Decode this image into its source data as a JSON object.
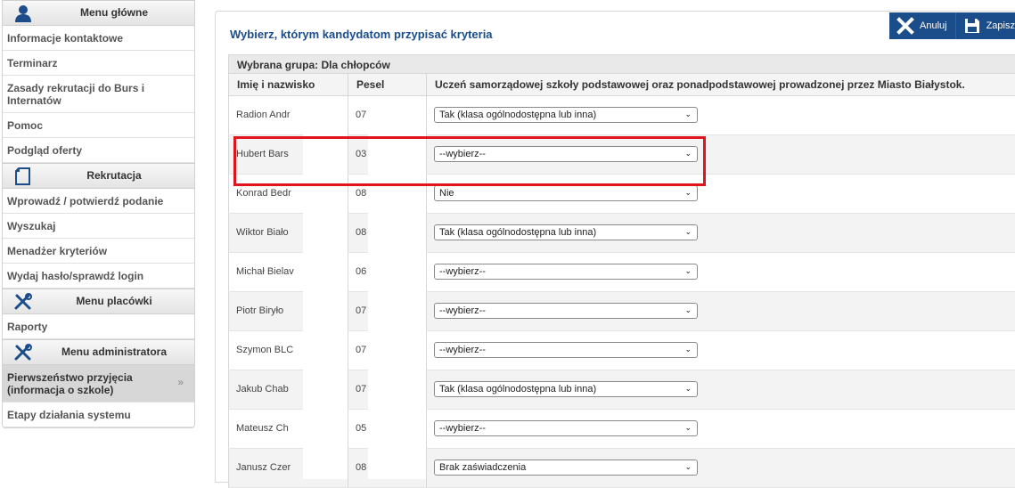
{
  "sidebar": {
    "menu_glowne": {
      "title": "Menu główne",
      "icon": "user-icon",
      "items": [
        {
          "label": "Informacje kontaktowe"
        },
        {
          "label": "Terminarz"
        },
        {
          "label": "Zasady rekrutacji do Burs i Internatów"
        },
        {
          "label": "Pomoc"
        },
        {
          "label": "Podgląd oferty"
        }
      ]
    },
    "rekrutacja": {
      "title": "Rekrutacja",
      "icon": "document-icon",
      "items": [
        {
          "label": "Wprowadź / potwierdź podanie"
        },
        {
          "label": "Wyszukaj"
        },
        {
          "label": "Menadżer kryteriów"
        },
        {
          "label": "Wydaj hasło/sprawdź login"
        }
      ]
    },
    "menu_placowki": {
      "title": "Menu placówki",
      "icon": "tools-icon",
      "items": [
        {
          "label": "Raporty"
        }
      ]
    },
    "menu_administratora": {
      "title": "Menu administratora",
      "icon": "tools-icon",
      "items": [
        {
          "label": "Pierwszeństwo przyjęcia (informacja o szkole)",
          "active": true,
          "chevron": "»"
        },
        {
          "label": "Etapy działania systemu"
        }
      ]
    }
  },
  "main": {
    "title": "Wybierz, którym kandydatom przypisać kryteria",
    "buttons": {
      "cancel": "Anuluj",
      "save": "Zapisz"
    },
    "group_label": "Wybrana grupa: Dla chłopców",
    "columns": [
      "Imię i nazwisko",
      "Pesel",
      "Uczeń samorządowej szkoły podstawowej oraz ponadpodstawowej prowadzonej przez Miasto Białystok."
    ],
    "rows": [
      {
        "name": "Radion Andr",
        "pesel": "07",
        "value": "Tak (klasa ogólnodostępna lub inna)"
      },
      {
        "name": "Hubert Bars",
        "pesel": "03",
        "value": "--wybierz--"
      },
      {
        "name": "Konrad Bedr",
        "pesel": "08",
        "value": "Nie"
      },
      {
        "name": "Wiktor Biało",
        "pesel": "08",
        "value": "Tak (klasa ogólnodostępna lub inna)"
      },
      {
        "name": "Michał Bielav",
        "pesel": "06",
        "value": "--wybierz--"
      },
      {
        "name": "Piotr Biryło",
        "pesel": "07",
        "value": "--wybierz--"
      },
      {
        "name": "Szymon BLC",
        "pesel": "07",
        "value": "--wybierz--"
      },
      {
        "name": "Jakub Chab",
        "pesel": "07",
        "value": "Tak (klasa ogólnodostępna lub inna)"
      },
      {
        "name": "Mateusz Ch",
        "pesel": "05",
        "value": "--wybierz--"
      },
      {
        "name": "Janusz Czer",
        "pesel": "08",
        "value": "Brak zaświadczenia"
      }
    ]
  },
  "colors": {
    "accent": "#1b4d8a",
    "highlight_box": "#e0141c"
  }
}
